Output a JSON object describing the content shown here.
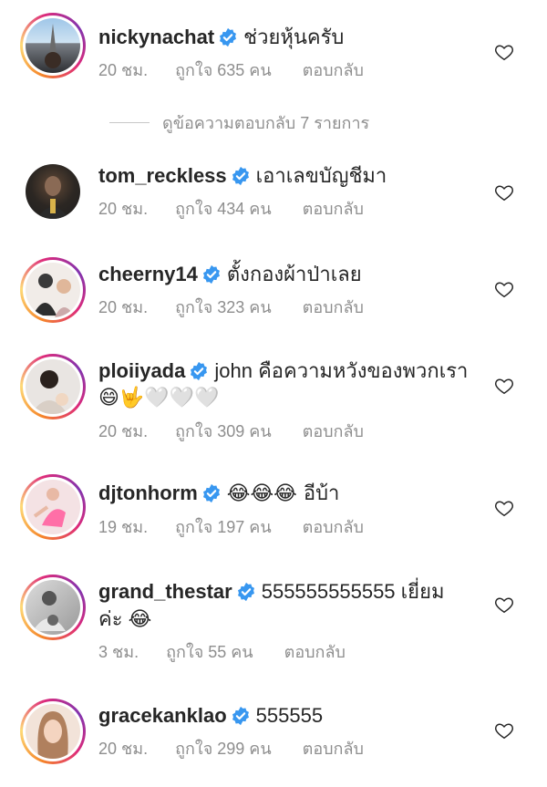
{
  "comments": [
    {
      "username": "nickynachat",
      "text": "ช่วยหุ้นครับ",
      "text2": "",
      "time": "20 ชม.",
      "likes": "ถูกใจ 635 คน",
      "reply": "ตอบกลับ",
      "ring": true
    },
    {
      "username": "tom_reckless",
      "text": "เอาเลขบัญชีมา",
      "text2": "",
      "time": "20 ชม.",
      "likes": "ถูกใจ 434 คน",
      "reply": "ตอบกลับ",
      "ring": false
    },
    {
      "username": "cheerny14",
      "text": "ตั้งกองผ้าป่าเลย",
      "text2": "",
      "time": "20 ชม.",
      "likes": "ถูกใจ 323 คน",
      "reply": "ตอบกลับ",
      "ring": true
    },
    {
      "username": "ploiiyada",
      "text": "john คือความหวังของพวกเรา",
      "text2": "😄🤟🤍🤍🤍",
      "time": "20 ชม.",
      "likes": "ถูกใจ 309 คน",
      "reply": "ตอบกลับ",
      "ring": true
    },
    {
      "username": "djtonhorm",
      "text": "😂😂😂 อีบ้า",
      "text2": "",
      "time": "19 ชม.",
      "likes": "ถูกใจ 197 คน",
      "reply": "ตอบกลับ",
      "ring": true
    },
    {
      "username": "grand_thestar",
      "text": "555555555555 เยี่ยม",
      "text2": "ค่ะ 😂",
      "time": "3 ชม.",
      "likes": "ถูกใจ 55 คน",
      "reply": "ตอบกลับ",
      "ring": true
    },
    {
      "username": "gracekanklao",
      "text": "555555",
      "text2": "",
      "time": "20 ชม.",
      "likes": "ถูกใจ 299 คน",
      "reply": "ตอบกลับ",
      "ring": true
    }
  ],
  "view_replies": "ดูข้อความตอบกลับ 7 รายการ",
  "colors": {
    "verified": "#3897f0",
    "meta": "#8e8e8e",
    "text": "#262626"
  },
  "icons": {
    "verified": "verified-badge-icon",
    "like": "heart-outline-icon"
  }
}
